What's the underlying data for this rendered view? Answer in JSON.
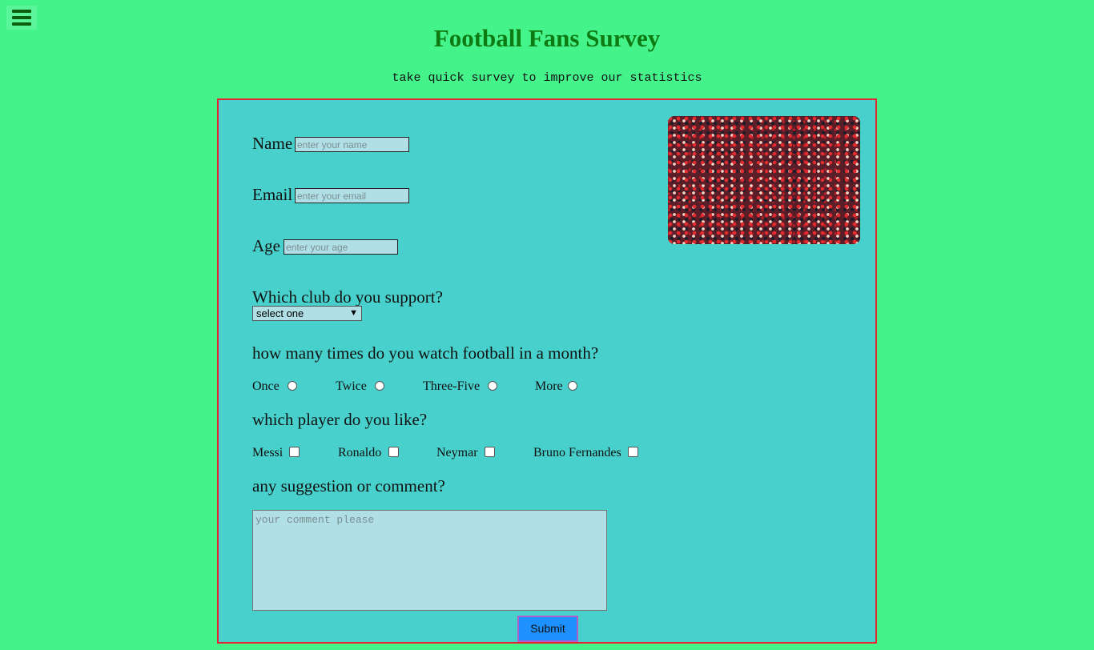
{
  "header": {
    "title": "Football Fans Survey",
    "subtitle": "take quick survey to improve our statistics"
  },
  "menu": {
    "icon": "hamburger-menu-icon"
  },
  "form": {
    "name_label": "Name",
    "name_placeholder": "enter your name",
    "email_label": "Email",
    "email_placeholder": "enter your email",
    "age_label": "Age",
    "age_placeholder": "enter your age",
    "club_question": "Which club do you support?",
    "club_selected": "select one",
    "watch_question": "how many times do you watch football in a month?",
    "watch_options": [
      "Once",
      "Twice",
      "Three-Five",
      "More"
    ],
    "player_question": "which player do you like?",
    "player_options": [
      "Messi",
      "Ronaldo",
      "Neymar",
      "Bruno Fernandes"
    ],
    "comment_question": "any suggestion or comment?",
    "comment_placeholder": "your comment please",
    "submit_label": "Submit"
  },
  "colors": {
    "page_bg": "#45f38b",
    "form_bg": "#48d1cc",
    "form_border": "#e5262e",
    "title": "#0d7a12",
    "input_bg": "#b0e0e6",
    "submit_bg": "#1e90ff"
  }
}
